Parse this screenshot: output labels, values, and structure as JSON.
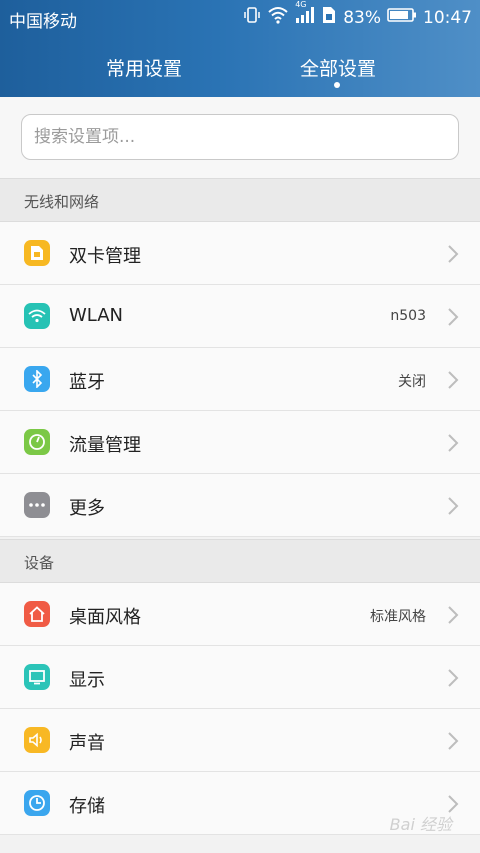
{
  "status": {
    "carrier": "中国移动",
    "network": "4G",
    "battery_pct": "83%",
    "time": "10:47"
  },
  "tabs": {
    "common": "常用设置",
    "all": "全部设置"
  },
  "search": {
    "placeholder": "搜索设置项..."
  },
  "sections": {
    "network": {
      "title": "无线和网络",
      "items": [
        {
          "label": "双卡管理",
          "value": "",
          "icon": "sim-card-icon",
          "color": "#f7b822"
        },
        {
          "label": "WLAN",
          "value": "n503",
          "icon": "wifi-icon",
          "color": "#26c2b4"
        },
        {
          "label": "蓝牙",
          "value": "关闭",
          "icon": "bluetooth-icon",
          "color": "#39a7ef"
        },
        {
          "label": "流量管理",
          "value": "",
          "icon": "data-usage-icon",
          "color": "#7bc846"
        },
        {
          "label": "更多",
          "value": "",
          "icon": "more-icon",
          "color": "#8e8e93"
        }
      ]
    },
    "device": {
      "title": "设备",
      "items": [
        {
          "label": "桌面风格",
          "value": "标准风格",
          "icon": "home-icon",
          "color": "#f05b45"
        },
        {
          "label": "显示",
          "value": "",
          "icon": "display-icon",
          "color": "#2bc4b8"
        },
        {
          "label": "声音",
          "value": "",
          "icon": "sound-icon",
          "color": "#f8b824"
        },
        {
          "label": "存储",
          "value": "",
          "icon": "storage-icon",
          "color": "#3aa6ee"
        }
      ]
    }
  },
  "watermark": "Bai 经验"
}
